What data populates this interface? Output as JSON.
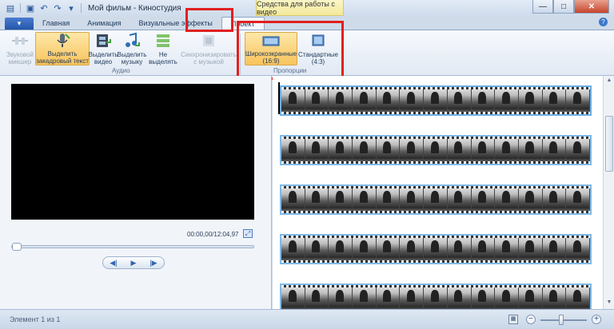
{
  "window": {
    "title": "Мой фильм - Киностудия",
    "context_tab_header": "Средства для работы с видео",
    "controls": {
      "minimize": "—",
      "maximize": "□",
      "close": "✕"
    }
  },
  "tabs": {
    "file": "▾",
    "items": [
      {
        "label": "Главная"
      },
      {
        "label": "Анимация"
      },
      {
        "label": "Визуальные эффекты"
      },
      {
        "label": "Проект",
        "active": true
      }
    ]
  },
  "ribbon": {
    "audio_group": {
      "label": "Аудио",
      "buttons": [
        {
          "label1": "Звуковой",
          "label2": "микшер",
          "disabled": true
        },
        {
          "label1": "Выделить",
          "label2": "закадровый текст",
          "selected": true
        },
        {
          "label1": "Выделить",
          "label2": "видео"
        },
        {
          "label1": "Выделить",
          "label2": "музыку"
        },
        {
          "label1": "Не",
          "label2": "выделять"
        },
        {
          "label1": "Синхронизировать",
          "label2": "с музыкой",
          "disabled": true
        }
      ]
    },
    "aspect_group": {
      "label": "Пропорции",
      "buttons": [
        {
          "label1": "Широкоэкранные",
          "label2": "(16:9)",
          "selected": true
        },
        {
          "label1": "Стандартные",
          "label2": "(4:3)"
        }
      ]
    }
  },
  "preview": {
    "timecode": "00:00,00/12:04,97",
    "playback": {
      "prev": "◀|",
      "play": "▶",
      "next": "|▶"
    }
  },
  "storyboard": {
    "clip_count": 5
  },
  "statusbar": {
    "text": "Элемент 1 из 1",
    "zoom_minus": "−",
    "zoom_plus": "+",
    "zoom_level": 0.45
  },
  "colors": {
    "accent": "#2456a9",
    "highlight": "#e02020",
    "selected": "#f8c45c"
  }
}
